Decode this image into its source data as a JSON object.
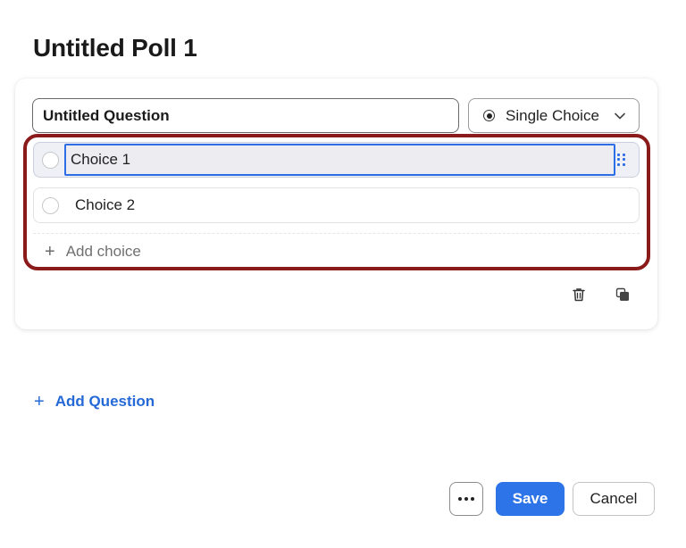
{
  "poll": {
    "title": "Untitled Poll 1"
  },
  "question": {
    "value": "Untitled Question",
    "type_label": "Single Choice",
    "type_icon": "radio-dot-icon",
    "choices": [
      {
        "value": "Choice 1",
        "active": true
      },
      {
        "value": "Choice 2",
        "active": false
      }
    ],
    "add_choice_label": "Add choice"
  },
  "add_question_label": "Add Question",
  "footer": {
    "more_icon": "more-icon",
    "save_label": "Save",
    "cancel_label": "Cancel"
  },
  "colors": {
    "accent": "#2d74e8",
    "link": "#2469d6",
    "highlight_border": "#8b1a1a"
  }
}
